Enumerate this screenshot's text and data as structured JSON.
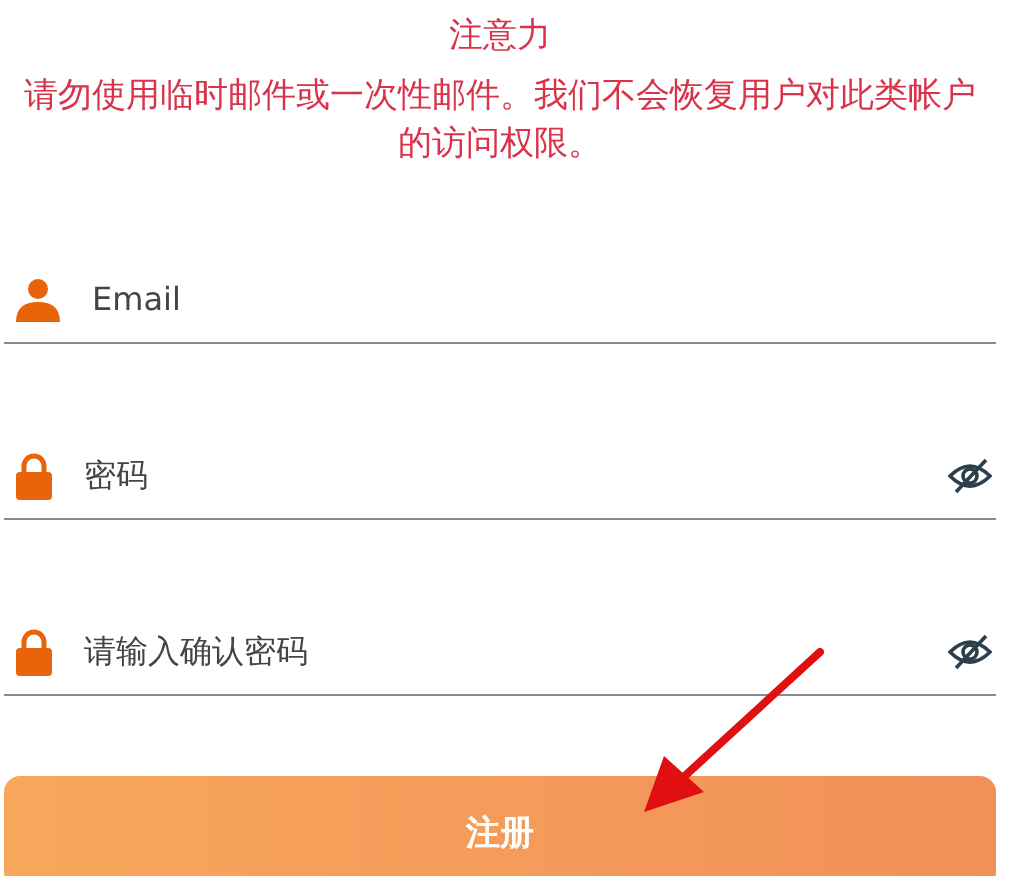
{
  "notice": {
    "title": "注意力",
    "message": "请勿使用临时邮件或一次性邮件。我们不会恢复用户对此类帐户的访问权限。"
  },
  "fields": [
    {
      "kind": "email",
      "placeholder": "Email"
    },
    {
      "kind": "password",
      "placeholder": "密码"
    },
    {
      "kind": "password",
      "placeholder": "请输入确认密码"
    }
  ],
  "submit": {
    "label": "注册"
  }
}
